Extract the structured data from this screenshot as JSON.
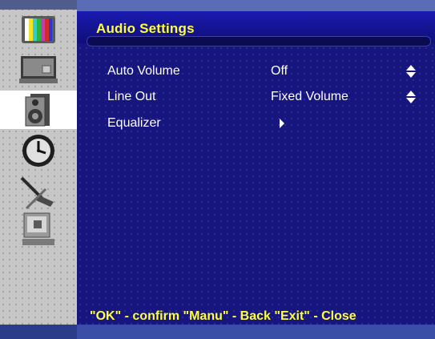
{
  "menu": {
    "title": "Audio Settings",
    "items": [
      {
        "label": "Auto Volume",
        "value": "Off",
        "control": "up-down-icon"
      },
      {
        "label": "Line Out",
        "value": "Fixed Volume",
        "control": "up-down-icon"
      },
      {
        "label": "Equalizer",
        "value": "",
        "control": "right-arrow-icon"
      }
    ],
    "footer": "\"OK\" - confirm \"Manu\" - Back \"Exit\" - Close"
  },
  "sidebar": {
    "icons": [
      "tv-color-bars-icon",
      "pc-monitor-icon",
      "speaker-icon",
      "clock-icon",
      "tools-icon",
      "computer-icon"
    ],
    "selected": "speaker-icon"
  },
  "colors": {
    "panel_bg": "#16167e",
    "title": "#ffff3a",
    "text": "#ffffff",
    "rail_bg": "#c6c6c6"
  }
}
